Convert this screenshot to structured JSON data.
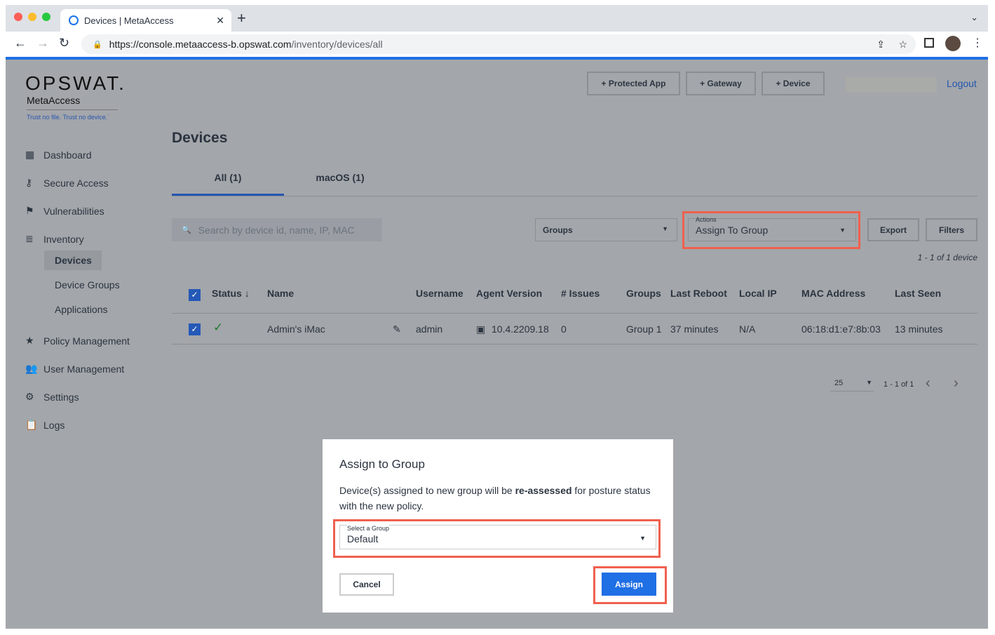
{
  "browser": {
    "tab_title": "Devices | MetaAccess",
    "url_host": "https://console.metaaccess-b.opswat.com",
    "url_path": "/inventory/devices/all"
  },
  "brand": {
    "logo": "OPSWAT.",
    "product": "MetaAccess",
    "tagline": "Trust no file. Trust no device.˙"
  },
  "header": {
    "buttons": [
      "+ Protected App",
      "+ Gateway",
      "+ Device"
    ],
    "logout": "Logout"
  },
  "sidebar": {
    "items": [
      {
        "label": "Dashboard",
        "icon": "dashboard-icon"
      },
      {
        "label": "Secure Access",
        "icon": "key-icon"
      },
      {
        "label": "Vulnerabilities",
        "icon": "flag-icon"
      },
      {
        "label": "Inventory",
        "icon": "list-icon"
      },
      {
        "label": "Policy Management",
        "icon": "star-icon"
      },
      {
        "label": "User Management",
        "icon": "users-icon"
      },
      {
        "label": "Settings",
        "icon": "gear-icon"
      },
      {
        "label": "Logs",
        "icon": "clipboard-icon"
      }
    ],
    "inventory_sub": [
      "Devices",
      "Device Groups",
      "Applications"
    ]
  },
  "page": {
    "title": "Devices",
    "tabs": [
      "All (1)",
      "macOS (1)"
    ],
    "search_placeholder": "Search by device id, name, IP, MAC",
    "groups_label": "Groups",
    "actions_label": "Actions",
    "actions_value": "Assign To Group",
    "export": "Export",
    "filters": "Filters",
    "count": "1 - 1 of 1 device"
  },
  "table": {
    "headers": [
      "Status",
      "Name",
      "Username",
      "Agent Version",
      "# Issues",
      "Groups",
      "Last Reboot",
      "Local IP",
      "MAC Address",
      "Last Seen"
    ],
    "rows": [
      {
        "name": "Admin's iMac",
        "username": "admin",
        "agent_version": "10.4.2209.18",
        "issues": "0",
        "groups": "Group 1",
        "last_reboot": "37 minutes",
        "local_ip": "N/A",
        "mac": "06:18:d1:e7:8b:03",
        "last_seen": "13 minutes"
      }
    ]
  },
  "pagination": {
    "per_page": "25",
    "range": "1 - 1 of 1"
  },
  "modal": {
    "title": "Assign to Group",
    "text_pre": "Device(s) assigned to new group will be ",
    "text_bold": "re-assessed",
    "text_post": " for posture status with the new policy.",
    "select_label": "Select a Group",
    "select_value": "Default",
    "cancel": "Cancel",
    "assign": "Assign"
  },
  "colors": {
    "accent": "#1f6fe5",
    "highlight": "#f0604f"
  }
}
